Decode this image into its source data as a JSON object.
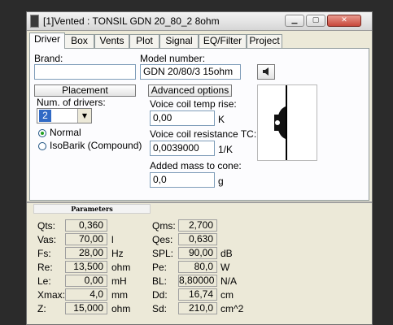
{
  "window": {
    "title": "[1]Vented : TONSIL GDN 20_80_2 8ohm",
    "controls": [
      "▁",
      "▢",
      "✕"
    ]
  },
  "tabs": [
    "Driver",
    "Box",
    "Vents",
    "Plot",
    "Signal",
    "EQ/Filter",
    "Project"
  ],
  "active_tab": "Driver",
  "driver": {
    "brand_label": "Brand:",
    "brand_value": "",
    "model_label": "Model number:",
    "model_value": "GDN 20/80/3 15ohm",
    "placement_button": "Placement",
    "advanced_button": "Advanced options",
    "num_drivers_label": "Num. of drivers:",
    "num_drivers_value": "2",
    "radio_normal": "Normal",
    "radio_isobarik": "IsoBarik (Compound)",
    "vc_temp_label": "Voice coil temp rise:",
    "vc_temp_value": "0,00",
    "vc_temp_unit": "K",
    "vc_res_label": "Voice coil resistance TC:",
    "vc_res_value": "0,0039000",
    "vc_res_unit": "1/K",
    "added_mass_label": "Added mass to cone:",
    "added_mass_value": "0,0",
    "added_mass_unit": "g"
  },
  "parameters": {
    "header": "Parameters",
    "left": [
      {
        "label": "Qts:",
        "value": "0,360",
        "unit": ""
      },
      {
        "label": "Vas:",
        "value": "70,00",
        "unit": "l"
      },
      {
        "label": "Fs:",
        "value": "28,00",
        "unit": "Hz"
      },
      {
        "label": "Re:",
        "value": "13,500",
        "unit": "ohm"
      },
      {
        "label": "Le:",
        "value": "0,00",
        "unit": "mH"
      },
      {
        "label": "Xmax:",
        "value": "4,0",
        "unit": "mm"
      },
      {
        "label": "Z:",
        "value": "15,000",
        "unit": "ohm"
      }
    ],
    "right": [
      {
        "label": "Qms:",
        "value": "2,700",
        "unit": ""
      },
      {
        "label": "Qes:",
        "value": "0,630",
        "unit": ""
      },
      {
        "label": "SPL:",
        "value": "90,00",
        "unit": "dB"
      },
      {
        "label": "Pe:",
        "value": "80,0",
        "unit": "W"
      },
      {
        "label": "BL:",
        "value": "8,80000",
        "unit": "N/A"
      },
      {
        "label": "Dd:",
        "value": "16,74",
        "unit": "cm"
      },
      {
        "label": "Sd:",
        "value": "210,0",
        "unit": "cm^2"
      }
    ]
  }
}
